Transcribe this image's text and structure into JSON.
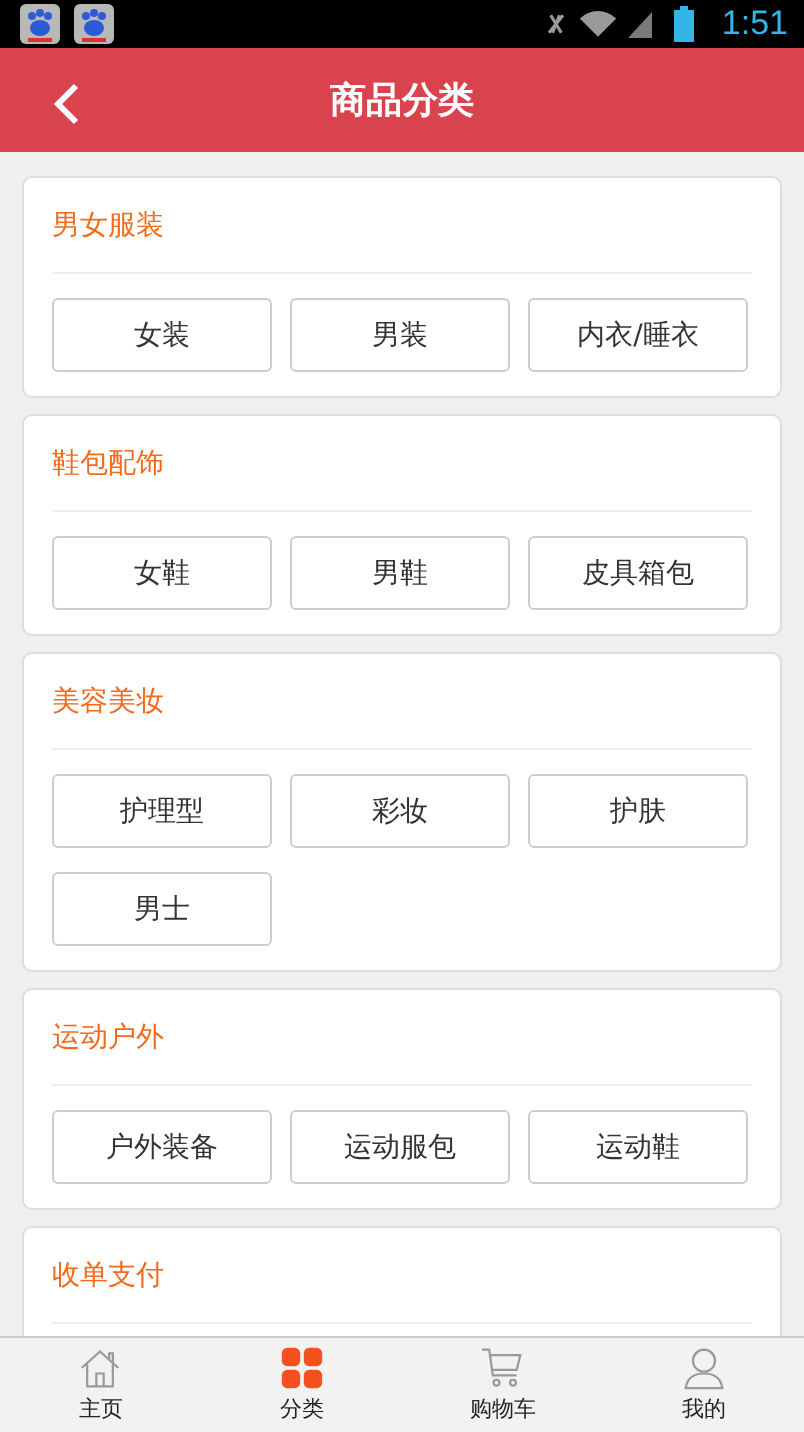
{
  "status_bar": {
    "time": "1:51",
    "notifications": [
      {
        "kind": "app"
      },
      {
        "kind": "app"
      }
    ]
  },
  "header": {
    "title": "商品分类"
  },
  "sections": [
    {
      "title": "男女服装",
      "items": [
        "女装",
        "男装",
        "内衣/睡衣"
      ]
    },
    {
      "title": "鞋包配饰",
      "items": [
        "女鞋",
        "男鞋",
        "皮具箱包"
      ]
    },
    {
      "title": "美容美妆",
      "items": [
        "护理型",
        "彩妆",
        "护肤",
        "男士"
      ]
    },
    {
      "title": "运动户外",
      "items": [
        "户外装备",
        "运动服包",
        "运动鞋"
      ]
    },
    {
      "title": "收单支付"
    }
  ],
  "tab_bar": [
    {
      "label": "主页",
      "kind": "home",
      "selected": false
    },
    {
      "label": "分类",
      "kind": "category",
      "selected": true
    },
    {
      "label": "购物车",
      "kind": "cart",
      "selected": false
    },
    {
      "label": "我的",
      "kind": "user",
      "selected": false
    }
  ]
}
